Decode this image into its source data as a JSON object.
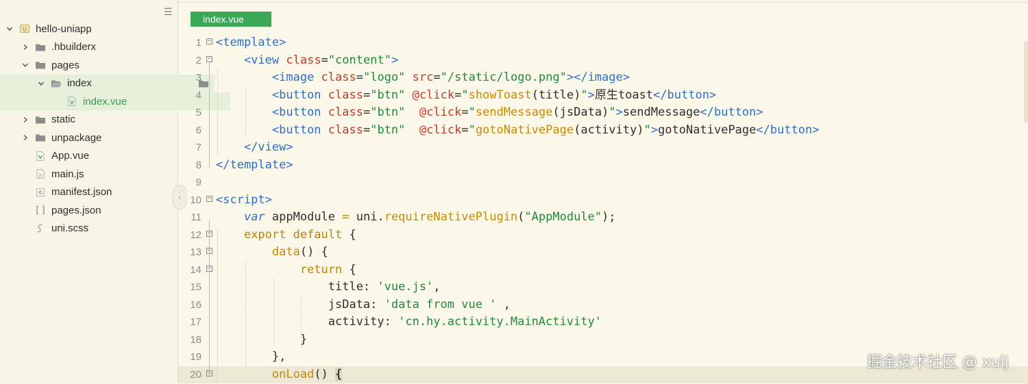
{
  "sidebar": {
    "items": [
      {
        "label": "hello-uniapp",
        "indent": 0,
        "chevron": "down",
        "icon": "project-icon"
      },
      {
        "label": ".hbuilderx",
        "indent": 1,
        "chevron": "right",
        "icon": "folder-icon"
      },
      {
        "label": "pages",
        "indent": 1,
        "chevron": "down",
        "icon": "folder-icon"
      },
      {
        "label": "index",
        "indent": 2,
        "chevron": "down",
        "icon": "folder-open-icon"
      },
      {
        "label": "index.vue",
        "indent": 3,
        "chevron": "none",
        "icon": "vue-file-icon"
      },
      {
        "label": "static",
        "indent": 1,
        "chevron": "right",
        "icon": "folder-icon"
      },
      {
        "label": "unpackage",
        "indent": 1,
        "chevron": "right",
        "icon": "folder-icon"
      },
      {
        "label": "App.vue",
        "indent": 1,
        "chevron": "none",
        "icon": "vue-file-icon"
      },
      {
        "label": "main.js",
        "indent": 1,
        "chevron": "none",
        "icon": "js-file-icon"
      },
      {
        "label": "manifest.json",
        "indent": 1,
        "chevron": "none",
        "icon": "json-file-icon"
      },
      {
        "label": "pages.json",
        "indent": 1,
        "chevron": "none",
        "icon": "brackets-icon"
      },
      {
        "label": "uni.scss",
        "indent": 1,
        "chevron": "none",
        "icon": "scss-file-icon"
      }
    ]
  },
  "editor": {
    "tab_label": "index.vue",
    "lines": [
      {
        "n": "1",
        "fold": true,
        "tokens": [
          [
            "t-tag",
            "<template>"
          ]
        ]
      },
      {
        "n": "2",
        "fold": true,
        "tokens": [
          [
            "t-plain",
            "    "
          ],
          [
            "t-tag",
            "<view "
          ],
          [
            "t-attr",
            "class"
          ],
          [
            "t-plain",
            "="
          ],
          [
            "t-str",
            "\"content\""
          ],
          [
            "t-tag",
            ">"
          ]
        ]
      },
      {
        "n": "3",
        "fold": false,
        "tokens": [
          [
            "t-plain",
            "        "
          ],
          [
            "t-tag",
            "<image "
          ],
          [
            "t-attr",
            "class"
          ],
          [
            "t-plain",
            "="
          ],
          [
            "t-str",
            "\"logo\""
          ],
          [
            "t-plain",
            " "
          ],
          [
            "t-attr",
            "src"
          ],
          [
            "t-plain",
            "="
          ],
          [
            "t-str",
            "\"/static/logo.png\""
          ],
          [
            "t-tag",
            "></image>"
          ]
        ]
      },
      {
        "n": "4",
        "fold": false,
        "tokens": [
          [
            "t-plain",
            "        "
          ],
          [
            "t-tag",
            "<button "
          ],
          [
            "t-attr",
            "class"
          ],
          [
            "t-plain",
            "="
          ],
          [
            "t-str",
            "\"btn\""
          ],
          [
            "t-plain",
            " "
          ],
          [
            "t-attr",
            "@click"
          ],
          [
            "t-plain",
            "="
          ],
          [
            "t-str",
            "\""
          ],
          [
            "t-func",
            "showToast"
          ],
          [
            "t-plain",
            "(title)"
          ],
          [
            "t-str",
            "\""
          ],
          [
            "t-tag",
            ">"
          ],
          [
            "t-plain",
            "原生toast"
          ],
          [
            "t-tag",
            "</button>"
          ]
        ]
      },
      {
        "n": "5",
        "fold": false,
        "tokens": [
          [
            "t-plain",
            "        "
          ],
          [
            "t-tag",
            "<button "
          ],
          [
            "t-attr",
            "class"
          ],
          [
            "t-plain",
            "="
          ],
          [
            "t-str",
            "\"btn\""
          ],
          [
            "t-plain",
            "  "
          ],
          [
            "t-attr",
            "@click"
          ],
          [
            "t-plain",
            "="
          ],
          [
            "t-str",
            "\""
          ],
          [
            "t-func",
            "sendMessage"
          ],
          [
            "t-plain",
            "(jsData)"
          ],
          [
            "t-str",
            "\""
          ],
          [
            "t-tag",
            ">"
          ],
          [
            "t-plain",
            "sendMessage"
          ],
          [
            "t-tag",
            "</button>"
          ]
        ]
      },
      {
        "n": "6",
        "fold": false,
        "tokens": [
          [
            "t-plain",
            "        "
          ],
          [
            "t-tag",
            "<button "
          ],
          [
            "t-attr",
            "class"
          ],
          [
            "t-plain",
            "="
          ],
          [
            "t-str",
            "\"btn\""
          ],
          [
            "t-plain",
            "  "
          ],
          [
            "t-attr",
            "@click"
          ],
          [
            "t-plain",
            "="
          ],
          [
            "t-str",
            "\""
          ],
          [
            "t-func",
            "gotoNativePage"
          ],
          [
            "t-plain",
            "(activity)"
          ],
          [
            "t-str",
            "\""
          ],
          [
            "t-tag",
            ">"
          ],
          [
            "t-plain",
            "gotoNativePage"
          ],
          [
            "t-tag",
            "</button>"
          ]
        ]
      },
      {
        "n": "7",
        "fold": false,
        "tokens": [
          [
            "t-plain",
            "    "
          ],
          [
            "t-tag",
            "</view>"
          ]
        ]
      },
      {
        "n": "8",
        "fold": false,
        "tokens": [
          [
            "t-tag",
            "</template>"
          ]
        ]
      },
      {
        "n": "9",
        "fold": false,
        "tokens": [
          [
            "t-plain",
            ""
          ]
        ]
      },
      {
        "n": "10",
        "fold": true,
        "tokens": [
          [
            "t-tag",
            "<script>"
          ]
        ]
      },
      {
        "n": "11",
        "fold": false,
        "tokens": [
          [
            "t-plain",
            "    "
          ],
          [
            "t-var",
            "var"
          ],
          [
            "t-plain",
            " appModule "
          ],
          [
            "t-kw",
            "="
          ],
          [
            "t-plain",
            " uni."
          ],
          [
            "t-fn2",
            "requireNativePlugin"
          ],
          [
            "t-plain",
            "("
          ],
          [
            "t-str2",
            "\"AppModule\""
          ],
          [
            "t-plain",
            ");"
          ]
        ]
      },
      {
        "n": "12",
        "fold": true,
        "tokens": [
          [
            "t-plain",
            "    "
          ],
          [
            "t-kw",
            "export default"
          ],
          [
            "t-plain",
            " {"
          ]
        ]
      },
      {
        "n": "13",
        "fold": true,
        "tokens": [
          [
            "t-plain",
            "        "
          ],
          [
            "t-fn2",
            "data"
          ],
          [
            "t-plain",
            "() {"
          ]
        ]
      },
      {
        "n": "14",
        "fold": true,
        "tokens": [
          [
            "t-plain",
            "            "
          ],
          [
            "t-kw",
            "return"
          ],
          [
            "t-plain",
            " {"
          ]
        ]
      },
      {
        "n": "15",
        "fold": false,
        "tokens": [
          [
            "t-plain",
            "                title: "
          ],
          [
            "t-str2",
            "'vue.js'"
          ],
          [
            "t-plain",
            ","
          ]
        ]
      },
      {
        "n": "16",
        "fold": false,
        "tokens": [
          [
            "t-plain",
            "                jsData: "
          ],
          [
            "t-str2",
            "'data from vue '"
          ],
          [
            "t-plain",
            " ,"
          ]
        ]
      },
      {
        "n": "17",
        "fold": false,
        "tokens": [
          [
            "t-plain",
            "                activity: "
          ],
          [
            "t-str2",
            "'cn.hy.activity.MainActivity'"
          ]
        ]
      },
      {
        "n": "18",
        "fold": false,
        "tokens": [
          [
            "t-plain",
            "            }"
          ]
        ]
      },
      {
        "n": "19",
        "fold": false,
        "tokens": [
          [
            "t-plain",
            "        },"
          ]
        ]
      },
      {
        "n": "20",
        "fold": true,
        "current": true,
        "tokens": [
          [
            "t-plain",
            "        "
          ],
          [
            "t-fn2",
            "onLoad"
          ],
          [
            "t-plain",
            "() "
          ],
          [
            "t-cursor",
            "{"
          ]
        ]
      }
    ]
  },
  "watermark": "掘金技术社区 @ xulj"
}
